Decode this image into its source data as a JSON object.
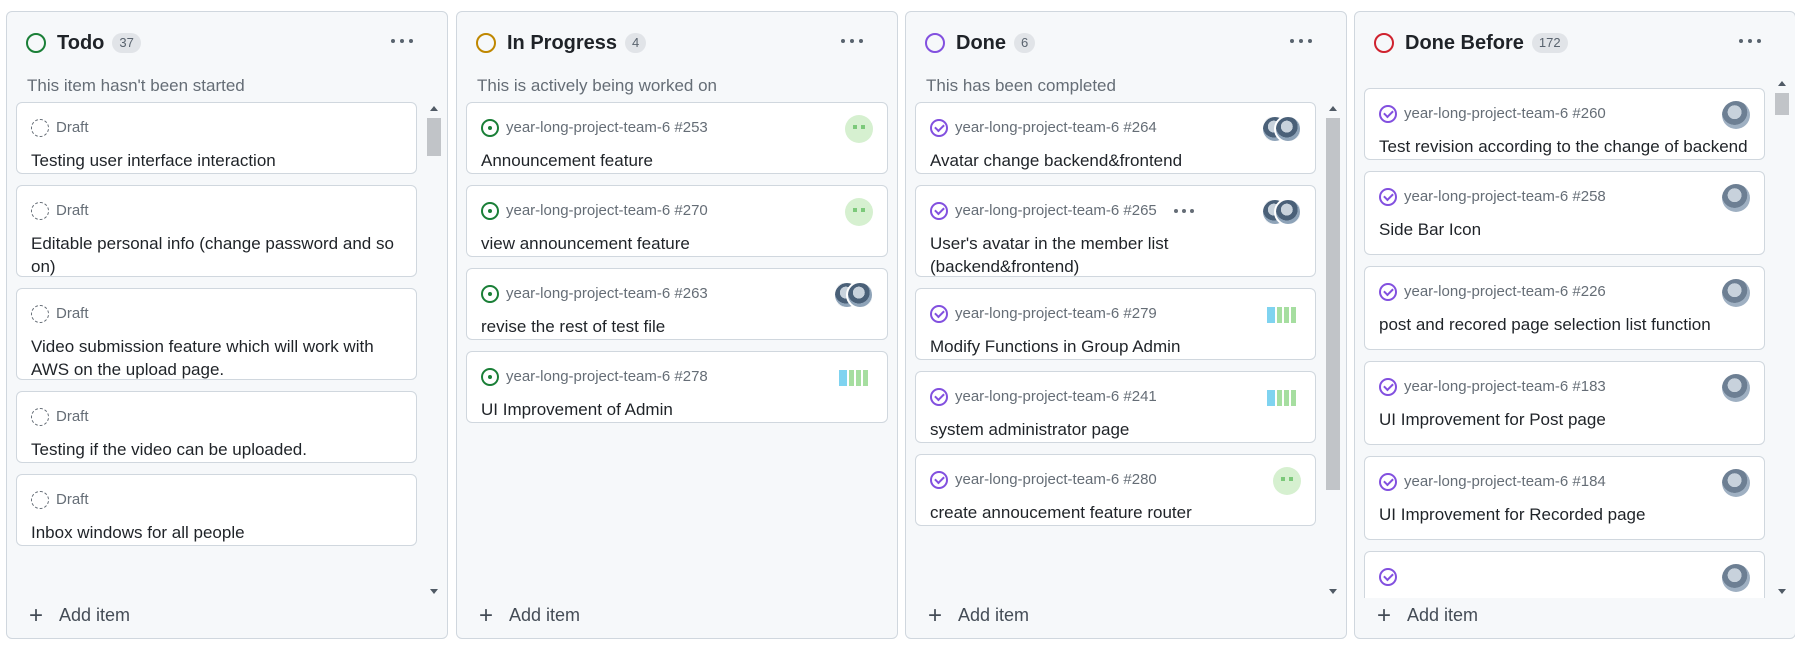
{
  "columns": [
    {
      "title": "Todo",
      "count": "37",
      "description": "This item hasn't been started",
      "color": "#1a7f37",
      "add_label": "Add item",
      "cards": [
        {
          "ref": "Draft",
          "title": "Testing user interface interaction"
        },
        {
          "ref": "Draft",
          "title": "Editable personal info (change password and so on)"
        },
        {
          "ref": "Draft",
          "title": "Video submission feature which will work with AWS on the upload page."
        },
        {
          "ref": "Draft",
          "title": "Testing if the video can be uploaded."
        },
        {
          "ref": "Draft",
          "title": "Inbox windows for all people"
        }
      ]
    },
    {
      "title": "In Progress",
      "count": "4",
      "description": "This is actively being worked on",
      "color": "#bf8700",
      "add_label": "Add item",
      "cards": [
        {
          "ref": "year-long-project-team-6 #253",
          "title": "Announcement feature"
        },
        {
          "ref": "year-long-project-team-6 #270",
          "title": "view announcement feature"
        },
        {
          "ref": "year-long-project-team-6 #263",
          "title": "revise the rest of test file"
        },
        {
          "ref": "year-long-project-team-6 #278",
          "title": "UI Improvement of Admin"
        }
      ]
    },
    {
      "title": "Done",
      "count": "6",
      "description": "This has been completed",
      "color": "#8250df",
      "add_label": "Add item",
      "cards": [
        {
          "ref": "year-long-project-team-6 #264",
          "title": "Avatar change backend&frontend"
        },
        {
          "ref": "year-long-project-team-6 #265",
          "title": "User's avatar in the member list (backend&frontend)"
        },
        {
          "ref": "year-long-project-team-6 #279",
          "title": "Modify Functions in Group Admin"
        },
        {
          "ref": "year-long-project-team-6 #241",
          "title": "system administrator page"
        },
        {
          "ref": "year-long-project-team-6 #280",
          "title": "create annoucement feature router"
        }
      ]
    },
    {
      "title": "Done Before",
      "count": "172",
      "description": "",
      "color": "#cf222e",
      "add_label": "Add item",
      "cards": [
        {
          "ref": "year-long-project-team-6 #260",
          "title": "Test revision according to the change of backend"
        },
        {
          "ref": "year-long-project-team-6 #258",
          "title": "Side Bar Icon"
        },
        {
          "ref": "year-long-project-team-6 #226",
          "title": "post and recored page selection list function"
        },
        {
          "ref": "year-long-project-team-6 #183",
          "title": "UI Improvement for Post page"
        },
        {
          "ref": "year-long-project-team-6 #184",
          "title": "UI Improvement for Recorded page"
        }
      ]
    }
  ],
  "icons": {
    "draft": "draft-circle-icon",
    "open": "issue-opened-icon",
    "done": "issue-closed-icon",
    "menu": "kebab-horizontal-icon",
    "add": "plus-icon"
  }
}
